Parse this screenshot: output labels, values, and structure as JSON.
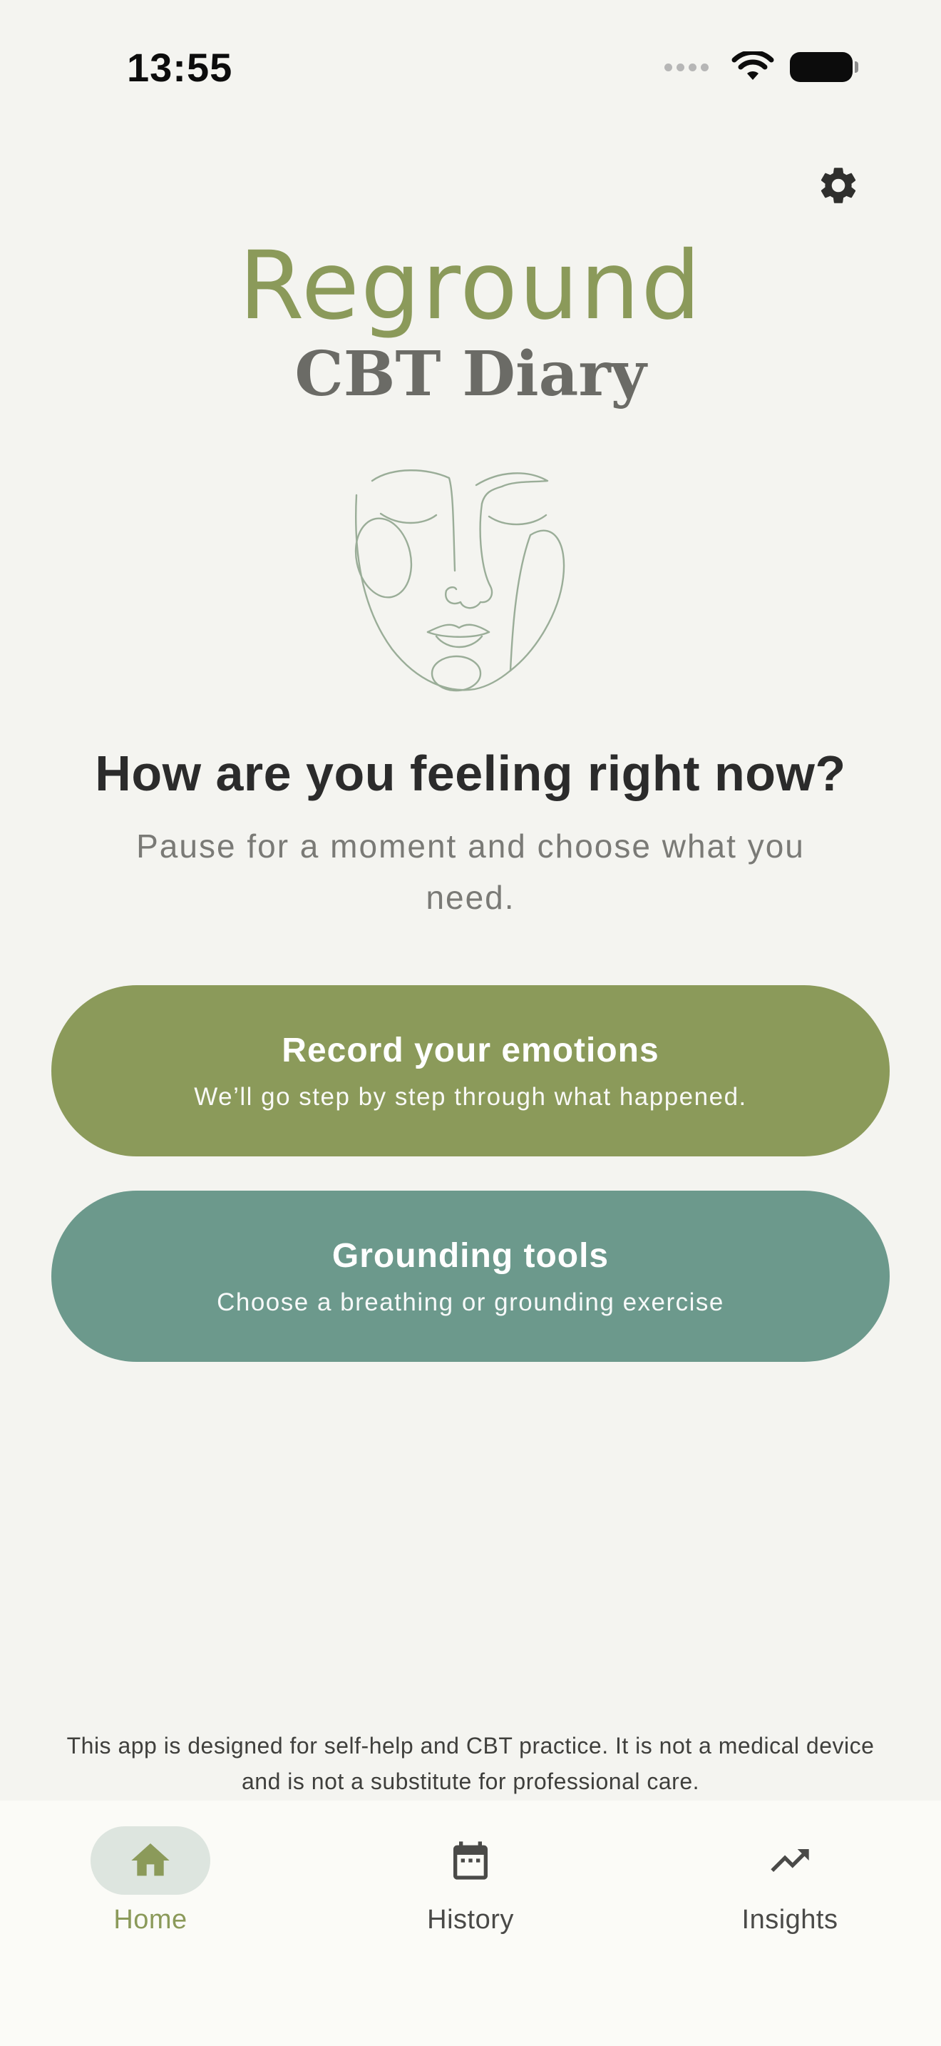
{
  "status_bar": {
    "time": "13:55"
  },
  "header": {
    "settings_icon": "gear-icon"
  },
  "brand": {
    "title": "Reground",
    "subtitle": "CBT Diary"
  },
  "main": {
    "headline": "How are you feeling right now?",
    "subhead": "Pause for a moment and choose what you need.",
    "actions": [
      {
        "title": "Record your emotions",
        "description": "We’ll go step by step through what happened.",
        "color": "#8b9a5a"
      },
      {
        "title": "Grounding tools",
        "description": "Choose a breathing or grounding exercise",
        "color": "#6c998c"
      }
    ]
  },
  "disclaimer": "This app is designed for self-help and CBT practice. It is not a medical device and is not a substitute for professional care.",
  "bottom_nav": {
    "items": [
      {
        "label": "Home",
        "icon": "home-icon",
        "active": true
      },
      {
        "label": "History",
        "icon": "calendar-icon",
        "active": false
      },
      {
        "label": "Insights",
        "icon": "trending-up-icon",
        "active": false
      }
    ]
  },
  "colors": {
    "accent": "#8b9a5a",
    "teal": "#6c998c",
    "background": "#f4f4f0",
    "nav_active_pill": "#dde5df"
  }
}
